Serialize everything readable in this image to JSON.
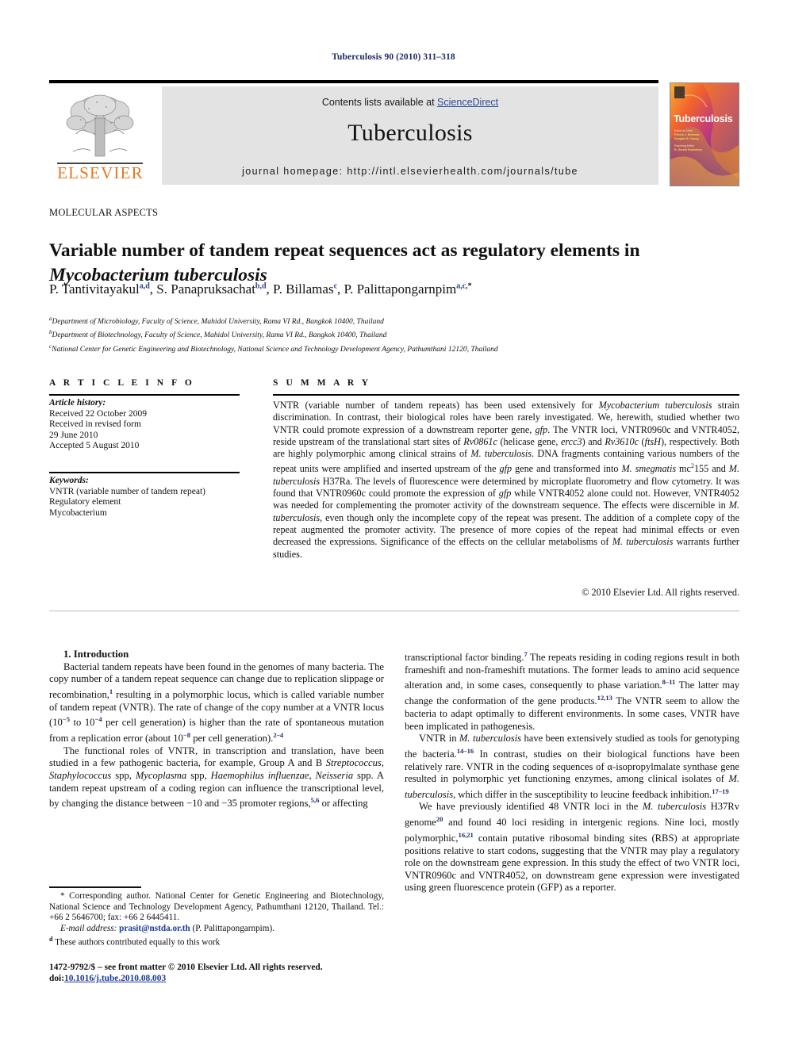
{
  "running_head": "Tuberculosis 90 (2010) 311–318",
  "masthead": {
    "contents_prefix": "Contents lists available at ",
    "sciencedirect": "ScienceDirect",
    "journal_title": "Tuberculosis",
    "homepage_label": "journal homepage: http://intl.elsevierhealth.com/journals/tube",
    "publisher": "ELSEVIER",
    "cover_title": "Tuberculosis",
    "cover_meta_line1": "Editor-in-Chief",
    "cover_meta_line2": "Patrick J. Brennan",
    "cover_meta_line3": "Douglas B. Young",
    "cover_meta_line4": "Founding Editor",
    "cover_meta_line5": "R. Gerald Robertson"
  },
  "section_label": "MOLECULAR ASPECTS",
  "title": {
    "line1": "Variable number of tandem repeat sequences act as regulatory elements in",
    "line2_italic": "Mycobacterium tuberculosis"
  },
  "authors": [
    {
      "name": "P. Tantivitayakul",
      "sup": "a,d",
      "sep": ", "
    },
    {
      "name": "S. Panapruksachat",
      "sup": "b,d",
      "sep": ", "
    },
    {
      "name": "P. Billamas",
      "sup": "c",
      "sep": ", "
    },
    {
      "name": "P. Palittapongarnpim",
      "sup": "a,c,",
      "star": "*",
      "sep": ""
    }
  ],
  "affiliations": [
    {
      "marker": "a",
      "text": "Department of Microbiology, Faculty of Science, Mahidol University, Rama VI Rd., Bangkok 10400, Thailand"
    },
    {
      "marker": "b",
      "text": "Department of Biotechnology, Faculty of Science, Mahidol University, Rama VI Rd., Bangkok 10400, Thailand"
    },
    {
      "marker": "c",
      "text": "National Center for Genetic Engineering and Biotechnology, National Science and Technology Development Agency, Pathumthani 12120, Thailand"
    }
  ],
  "info_head": "A R T I C L E  I N F O",
  "summary_head": "S U M M A R Y",
  "article_history": {
    "label": "Article history:",
    "lines": [
      "Received 22 October 2009",
      "Received in revised form",
      "29 June 2010",
      "Accepted 5 August 2010"
    ]
  },
  "keywords": {
    "label": "Keywords:",
    "items": [
      "VNTR (variable number of tandem repeat)",
      "Regulatory element",
      "Mycobacterium"
    ]
  },
  "summary_text": "VNTR (variable number of tandem repeats) has been used extensively for Mycobacterium tuberculosis strain discrimination. In contrast, their biological roles have been rarely investigated. We, herewith, studied whether two VNTR could promote expression of a downstream reporter gene, gfp. The VNTR loci, VNTR0960c and VNTR4052, reside upstream of the translational start sites of Rv0861c (helicase gene, ercc3) and Rv3610c (ftsH), respectively. Both are highly polymorphic among clinical strains of M. tuberculosis. DNA fragments containing various numbers of the repeat units were amplified and inserted upstream of the gfp gene and transformed into M. smegmatis mc2155 and M. tuberculosis H37Ra. The levels of fluorescence were determined by microplate fluorometry and flow cytometry. It was found that VNTR0960c could promote the expression of gfp while VNTR4052 alone could not. However, VNTR4052 was needed for complementing the promoter activity of the downstream sequence. The effects were discernible in M. tuberculosis, even though only the incomplete copy of the repeat was present. The addition of a complete copy of the repeat augmented the promoter activity. The presence of more copies of the repeat had minimal effects or even decreased the expressions. Significance of the effects on the cellular metabolisms of M. tuberculosis warrants further studies.",
  "copyright": "© 2010 Elsevier Ltd. All rights reserved.",
  "body": {
    "intro_heading": "1. Introduction",
    "left_paragraphs": [
      "Bacterial tandem repeats have been found in the genomes of many bacteria. The copy number of a tandem repeat sequence can change due to replication slippage or recombination,1 resulting in a polymorphic locus, which is called variable number of tandem repeat (VNTR). The rate of change of the copy number at a VNTR locus (10−5 to 10−4 per cell generation) is higher than the rate of spontaneous mutation from a replication error (about 10−8 per cell generation).2–4",
      "The functional roles of VNTR, in transcription and translation, have been studied in a few pathogenic bacteria, for example, Group A and B Streptococcus, Staphylococcus spp, Mycoplasma spp, Haemophilus influenzae, Neisseria spp. A tandem repeat upstream of a coding region can influence the transcriptional level, by changing the distance between −10 and −35 promoter regions,5,6 or affecting"
    ],
    "right_paragraphs": [
      "transcriptional factor binding.7 The repeats residing in coding regions result in both frameshift and non-frameshift mutations. The former leads to amino acid sequence alteration and, in some cases, consequently to phase variation.8–11 The latter may change the conformation of the gene products.12,13 The VNTR seem to allow the bacteria to adapt optimally to different environments. In some cases, VNTR have been implicated in pathogenesis.",
      "VNTR in M. tuberculosis have been extensively studied as tools for genotyping the bacteria.14–16 In contrast, studies on their biological functions have been relatively rare. VNTR in the coding sequences of α-isopropylmalate synthase gene resulted in polymorphic yet functioning enzymes, among clinical isolates of M. tuberculosis, which differ in the susceptibility to leucine feedback inhibition.17–19",
      "We have previously identified 48 VNTR loci in the M. tuberculosis H37Rv genome20 and found 40 loci residing in intergenic regions. Nine loci, mostly polymorphic,16,21 contain putative ribosomal binding sites (RBS) at appropriate positions relative to start codons, suggesting that the VNTR may play a regulatory role on the downstream gene expression. In this study the effect of two VNTR loci, VNTR0960c and VNTR4052, on downstream gene expression were investigated using green fluorescence protein (GFP) as a reporter."
    ]
  },
  "footnotes": {
    "corresponding": "* Corresponding author. National Center for Genetic Engineering and Biotechnology, National Science and Technology Development Agency, Pathumthani 12120, Thailand. Tel.: +66 2 5646700; fax: +66 2 6445411.",
    "email_label": "E-mail address:",
    "email": "prasit@nstda.or.th",
    "email_owner": "(P. Palittapongarnpim).",
    "equal_marker": "d",
    "equal_contrib": "These authors contributed equally to this work"
  },
  "imprint": {
    "line1": "1472-9792/$ – see front matter © 2010 Elsevier Ltd. All rights reserved.",
    "doi_prefix": "doi:",
    "doi": "10.1016/j.tube.2010.08.003"
  },
  "colors": {
    "link": "#2b4b9b",
    "elsevier_orange": "#E87722",
    "running_head": "#1b2a63",
    "band_grey": "#e3e3e3"
  }
}
